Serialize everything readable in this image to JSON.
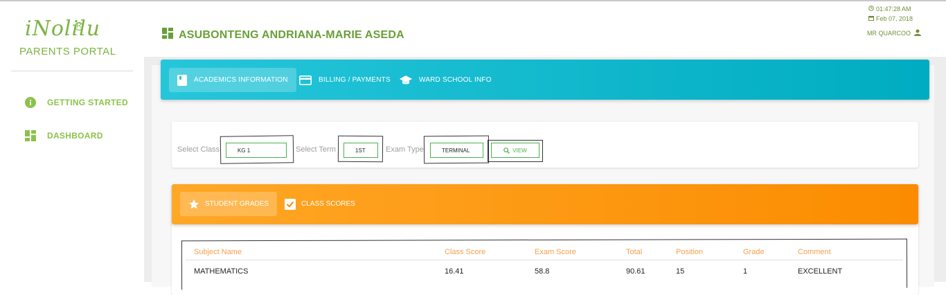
{
  "logo": {
    "brand": "iNolilu",
    "registered": "R",
    "subtitle": "PARENTS PORTAL"
  },
  "sidebar": {
    "items": [
      {
        "label": "GETTING STARTED",
        "icon": "info-icon"
      },
      {
        "label": "DASHBOARD",
        "icon": "dashboard-icon"
      }
    ]
  },
  "header": {
    "title": "ASUBONTENG ANDRIANA-MARIE ASEDA",
    "time": "01:47:28 AM",
    "date": "Feb 07, 2018",
    "user": "MR QUARCOO"
  },
  "tabs": [
    {
      "label": "ACADEMICS INFORMATION",
      "icon": "book-icon",
      "active": true
    },
    {
      "label": "BILLING / PAYMENTS",
      "icon": "credit-card-icon",
      "active": false
    },
    {
      "label": "WARD SCHOOL INFO",
      "icon": "graduation-cap-icon",
      "active": false
    }
  ],
  "filters": {
    "class_label": "Select Class",
    "class_value": "KG 1",
    "term_label": "Select Term",
    "term_value": "1ST",
    "exam_label": "Exam Type",
    "exam_value": "TERMINAL",
    "view_label": "VIEW"
  },
  "grade_tabs": [
    {
      "label": "STUDENT GRADES",
      "icon": "star-icon",
      "active": true
    },
    {
      "label": "CLASS SCORES",
      "icon": "checkbox-icon",
      "active": false
    }
  ],
  "table": {
    "headers": [
      "Subject Name",
      "Class Score",
      "Exam Score",
      "Total",
      "Position",
      "Grade",
      "Comment"
    ],
    "rows": [
      [
        "MATHEMATICS",
        "16.41",
        "58.8",
        "90.61",
        "15",
        "1",
        "EXCELLENT"
      ]
    ]
  },
  "colors": {
    "green": "#7cb342",
    "teal": "#00acc1",
    "orange": "#fb8c00",
    "header_text": "#f5a04a"
  }
}
